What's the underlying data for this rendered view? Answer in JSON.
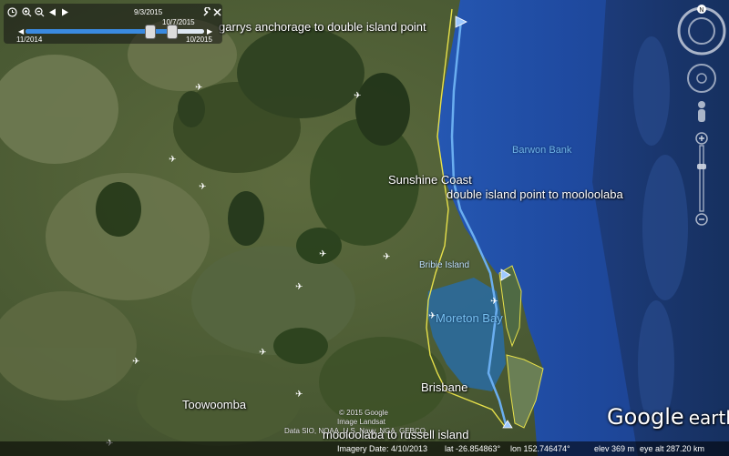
{
  "time_slider": {
    "current_date": "9/3/2015",
    "selected_date": "10/7/2015",
    "start_date": "11/2014",
    "end_date": "10/2015",
    "progress": 0.82
  },
  "track_labels": {
    "segment_1": "garrys anchorage to double island point",
    "segment_2": "double island point to mooloolaba",
    "segment_3": "mooloolaba to russell island"
  },
  "places": {
    "sunshine_coast": "Sunshine Coast",
    "brisbane": "Brisbane",
    "toowoomba": "Toowoomba"
  },
  "water": {
    "barwon_bank": "Barwon Bank",
    "moreton_bay": "Moreton Bay"
  },
  "islands": {
    "bribie": "Bribie Island"
  },
  "copyright": {
    "line1": "© 2015 Google",
    "line2": "Image Landsat",
    "line3": "Data SIO, NOAA, U.S. Navy, NGA, GEBCO"
  },
  "status_bar": {
    "imagery_date": "Imagery Date: 4/10/2013",
    "lat": "lat  -26.854863°",
    "lon": "lon  152.746474°",
    "elev": "elev   369 m",
    "eye_alt": "eye alt 287.20 km"
  },
  "logo": {
    "google": "Google",
    "earth": "earth"
  },
  "colors": {
    "ocean_deep": "#1c3f8a",
    "track": "#6aaef0",
    "coastline": "#e6e04a"
  }
}
